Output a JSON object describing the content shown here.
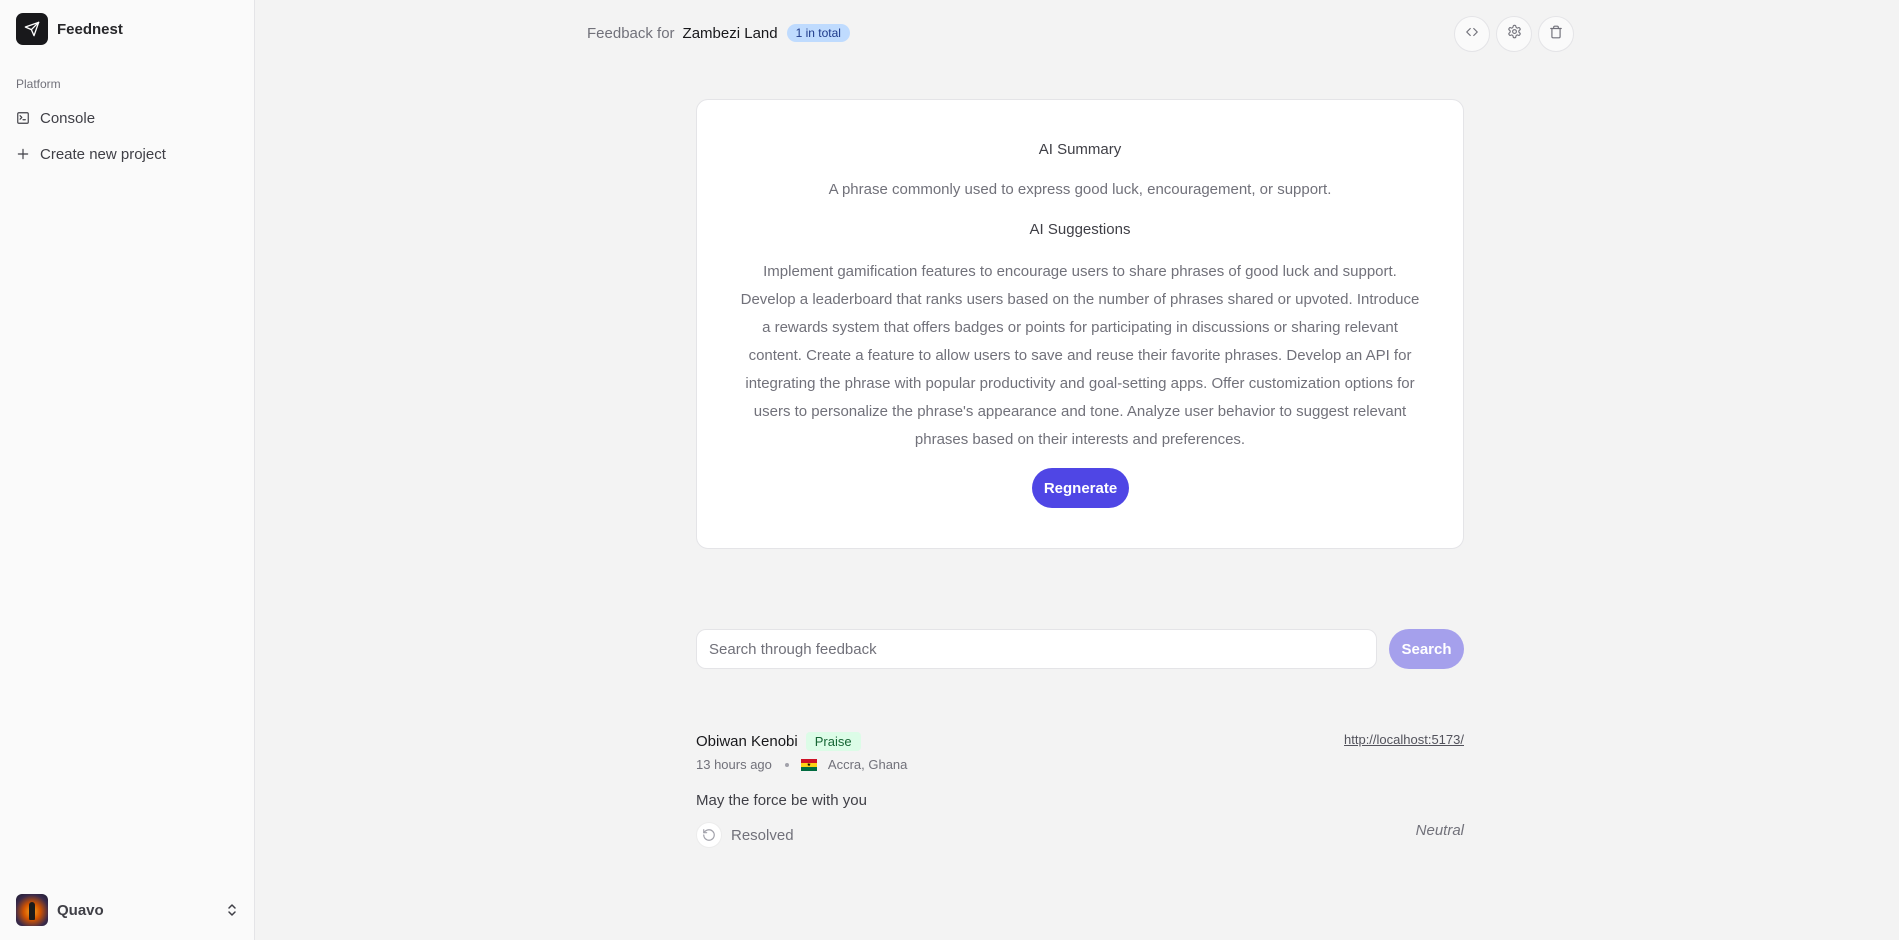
{
  "sidebar": {
    "brand": {
      "name": "Feednest",
      "icon": "send-icon"
    },
    "section_label": "Platform",
    "items": [
      {
        "label": "Console",
        "icon": "terminal-icon"
      },
      {
        "label": "Create new project",
        "icon": "plus-icon"
      }
    ],
    "user": {
      "name": "Quavo",
      "icon": "chevrons-up-down-icon"
    }
  },
  "header": {
    "prefix": "Feedback for",
    "project": "Zambezi Land",
    "badge": "1 in total",
    "actions": [
      {
        "name": "embed-code",
        "icon": "code-icon"
      },
      {
        "name": "settings",
        "icon": "gear-icon"
      },
      {
        "name": "delete",
        "icon": "trash-icon"
      }
    ]
  },
  "ai_card": {
    "summary_title": "AI Summary",
    "summary": "A phrase commonly used to express good luck, encouragement, or support.",
    "suggestions_title": "AI Suggestions",
    "suggestions": "Implement gamification features to encourage users to share phrases of good luck and support. Develop a leaderboard that ranks users based on the number of phrases shared or upvoted. Introduce a rewards system that offers badges or points for participating in discussions or sharing relevant content. Create a feature to allow users to save and reuse their favorite phrases. Develop an API for integrating the phrase with popular productivity and goal-setting apps. Offer customization options for users to personalize the phrase's appearance and tone. Analyze user behavior to suggest relevant phrases based on their interests and preferences.",
    "regenerate_label": "Regnerate"
  },
  "search": {
    "placeholder": "Search through feedback",
    "value": "",
    "button_label": "Search"
  },
  "feedback": [
    {
      "author": "Obiwan Kenobi",
      "tag": "Praise",
      "time": "13 hours ago",
      "country_flag": "ghana-flag",
      "location": "Accra, Ghana",
      "url": "http://localhost:5173/",
      "message": "May the force be with you",
      "status": "Resolved",
      "sentiment": "Neutral"
    }
  ],
  "colors": {
    "primary": "#4f46e5",
    "primary_disabled": "#a5a0ec",
    "badge_bg": "#bfdbfe",
    "tag_bg": "#dcfce7"
  }
}
